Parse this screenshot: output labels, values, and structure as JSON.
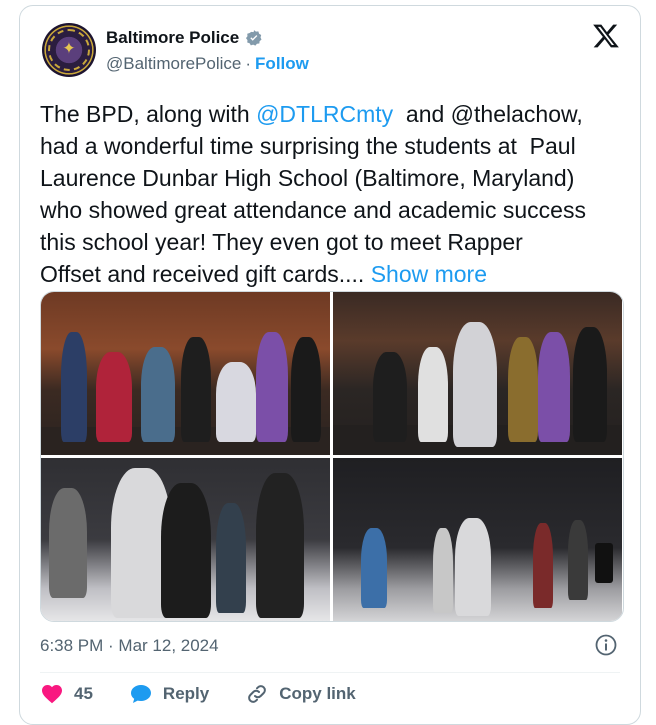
{
  "author": {
    "display_name": "Baltimore Police",
    "handle": "@BaltimorePolice",
    "separator": "·",
    "follow_label": "Follow"
  },
  "tweet": {
    "text_parts": [
      "The BPD, along with ",
      "@DTLRCmty",
      "  and @thelachow,\nhad a wonderful time surprising the students at  Paul\nLaurence Dunbar High School (Baltimore, Maryland)\nwho showed great attendance and academic success\nthis school year! They even got to meet Rapper\nOffset and received gift cards.... ",
      "Show more"
    ]
  },
  "media": {
    "photo_count": 4
  },
  "meta": {
    "timestamp": "6:38 PM · Mar 12, 2024"
  },
  "actions": {
    "like_count": "45",
    "reply_label": "Reply",
    "copy_link_label": "Copy link"
  },
  "icons": {
    "verified": "verified-badge-icon",
    "x_logo": "x-logo-icon",
    "info": "info-icon",
    "heart": "heart-icon",
    "reply": "reply-bubble-icon",
    "link": "link-icon"
  },
  "colors": {
    "accent": "#1d9bf0",
    "like": "#f91880",
    "muted": "#536471"
  }
}
